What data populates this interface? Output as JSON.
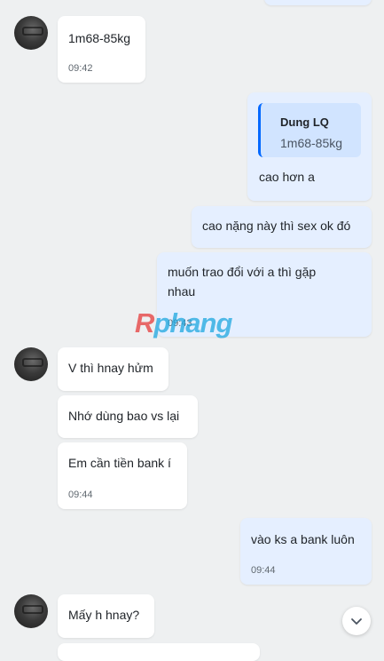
{
  "messages": [
    {
      "dir": "in",
      "text": "1m68-85kg",
      "time": "09:42"
    },
    {
      "dir": "out",
      "quote_author": "Dung LQ",
      "quote_text": "1m68-85kg",
      "text": "cao hơn a"
    },
    {
      "dir": "out",
      "text": "cao nặng này thì sex ok đó"
    },
    {
      "dir": "out",
      "text": "muốn trao đổi với a thì gặp\nnhau",
      "time": "09:43"
    },
    {
      "dir": "in",
      "text": "V thì hnay hửm"
    },
    {
      "dir": "in",
      "text": "Nhớ dùng bao vs lại"
    },
    {
      "dir": "in",
      "text": "Em cần tiền bank í",
      "time": "09:44"
    },
    {
      "dir": "out",
      "text": "vào ks a bank luôn",
      "time": "09:44"
    },
    {
      "dir": "in",
      "text": "Mấy h hnay?"
    }
  ],
  "watermark": {
    "part1": "R",
    "part2": "phang"
  },
  "scroll_down_icon": "chevron-down-icon"
}
